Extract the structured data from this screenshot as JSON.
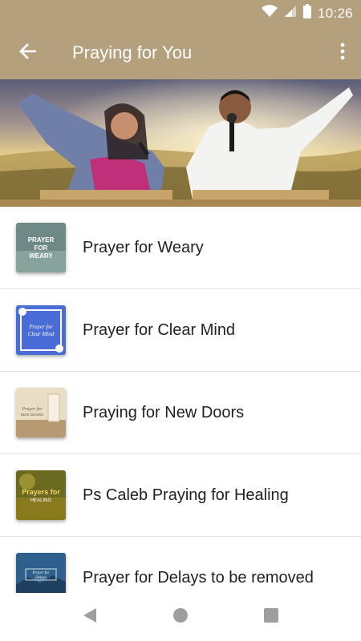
{
  "status_bar": {
    "time": "10:26",
    "icons": [
      "wifi-icon",
      "cell-signal-icon",
      "battery-icon"
    ],
    "background": "#b5a07e"
  },
  "app_bar": {
    "title": "Praying for You",
    "back_icon": "arrow-back-icon",
    "menu_icon": "more-vert-icon",
    "background": "#b5a07e"
  },
  "hero": {
    "description_icon": "hero-worship-image"
  },
  "list": {
    "items": [
      {
        "title": "Prayer for Weary",
        "thumb_text": [
          "PRAYER",
          "FOR",
          "WEARY"
        ]
      },
      {
        "title": "Prayer for Clear Mind",
        "thumb_text": [
          "Prayer for",
          "Clear Mind"
        ]
      },
      {
        "title": "Praying for New Doors",
        "thumb_text": [
          "Prayer for",
          "NEW DOORS"
        ]
      },
      {
        "title": "Ps Caleb Praying for Healing",
        "thumb_text": [
          "Prayers for",
          "HEALING"
        ]
      },
      {
        "title": "Prayer for Delays to be removed",
        "thumb_text": [
          "Prayer for",
          "Delays"
        ]
      }
    ]
  },
  "nav_bar": {
    "icons": [
      "back-triangle-icon",
      "home-circle-icon",
      "recents-square-icon"
    ]
  }
}
